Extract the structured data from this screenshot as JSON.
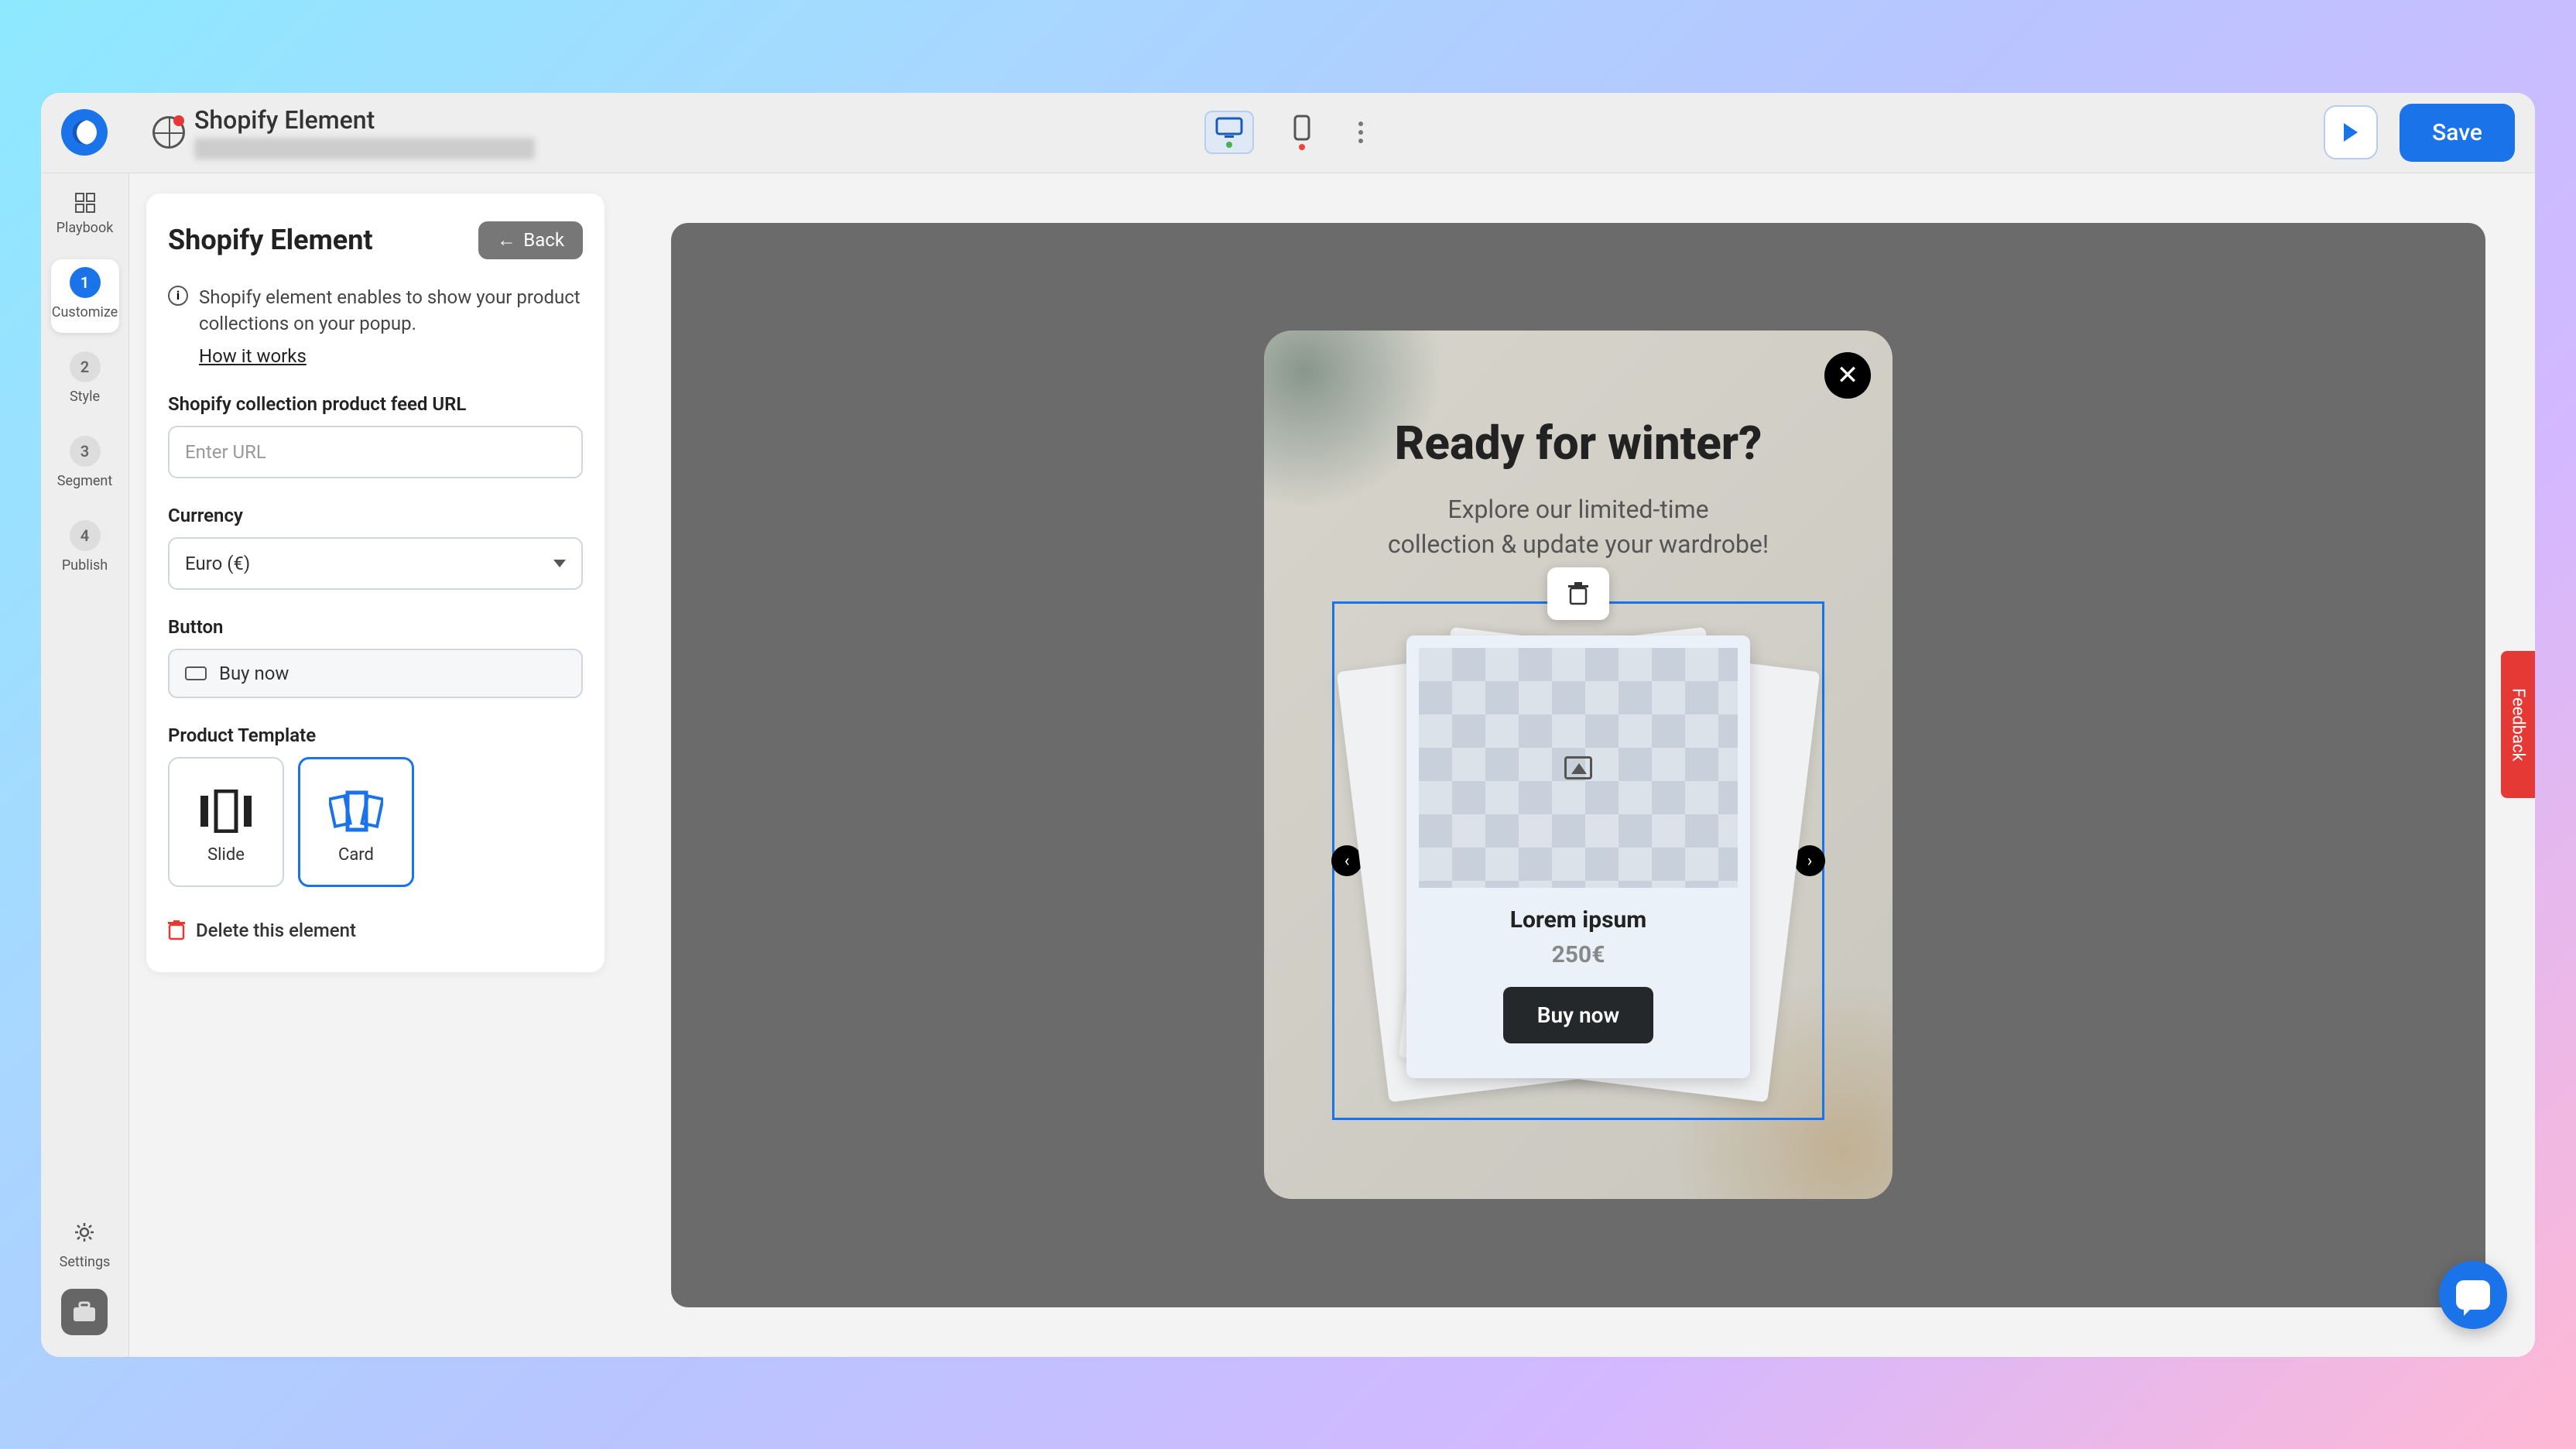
{
  "header": {
    "page_title": "Shopify Element",
    "save_label": "Save"
  },
  "viewport": {
    "desktop_active": true,
    "mobile_active": false
  },
  "nav_rail": {
    "steps": [
      {
        "num": "1",
        "label": "Customize",
        "active": true
      },
      {
        "num": "2",
        "label": "Style"
      },
      {
        "num": "3",
        "label": "Segment"
      },
      {
        "num": "4",
        "label": "Publish"
      }
    ],
    "playbook_label": "Playbook",
    "settings_label": "Settings"
  },
  "panel": {
    "title": "Shopify Element",
    "back_label": "Back",
    "info_text": "Shopify element enables to show your product collections on your popup.",
    "how_link": "How it works",
    "url_label": "Shopify collection product feed URL",
    "url_placeholder": "Enter URL",
    "url_value": "",
    "currency_label": "Currency",
    "currency_value": "Euro (€)",
    "button_label": "Button",
    "button_value": "Buy now",
    "template_label": "Product Template",
    "templates": [
      {
        "label": "Slide",
        "active": false
      },
      {
        "label": "Card",
        "active": true
      }
    ],
    "delete_label": "Delete this element"
  },
  "popup": {
    "title": "Ready for winter?",
    "subtitle_l1": "Explore our limited-time",
    "subtitle_l2": "collection & update your wardrobe!",
    "product_name": "Lorem ipsum",
    "product_price": "250€",
    "buy_label": "Buy now"
  },
  "feedback_label": "Feedback"
}
